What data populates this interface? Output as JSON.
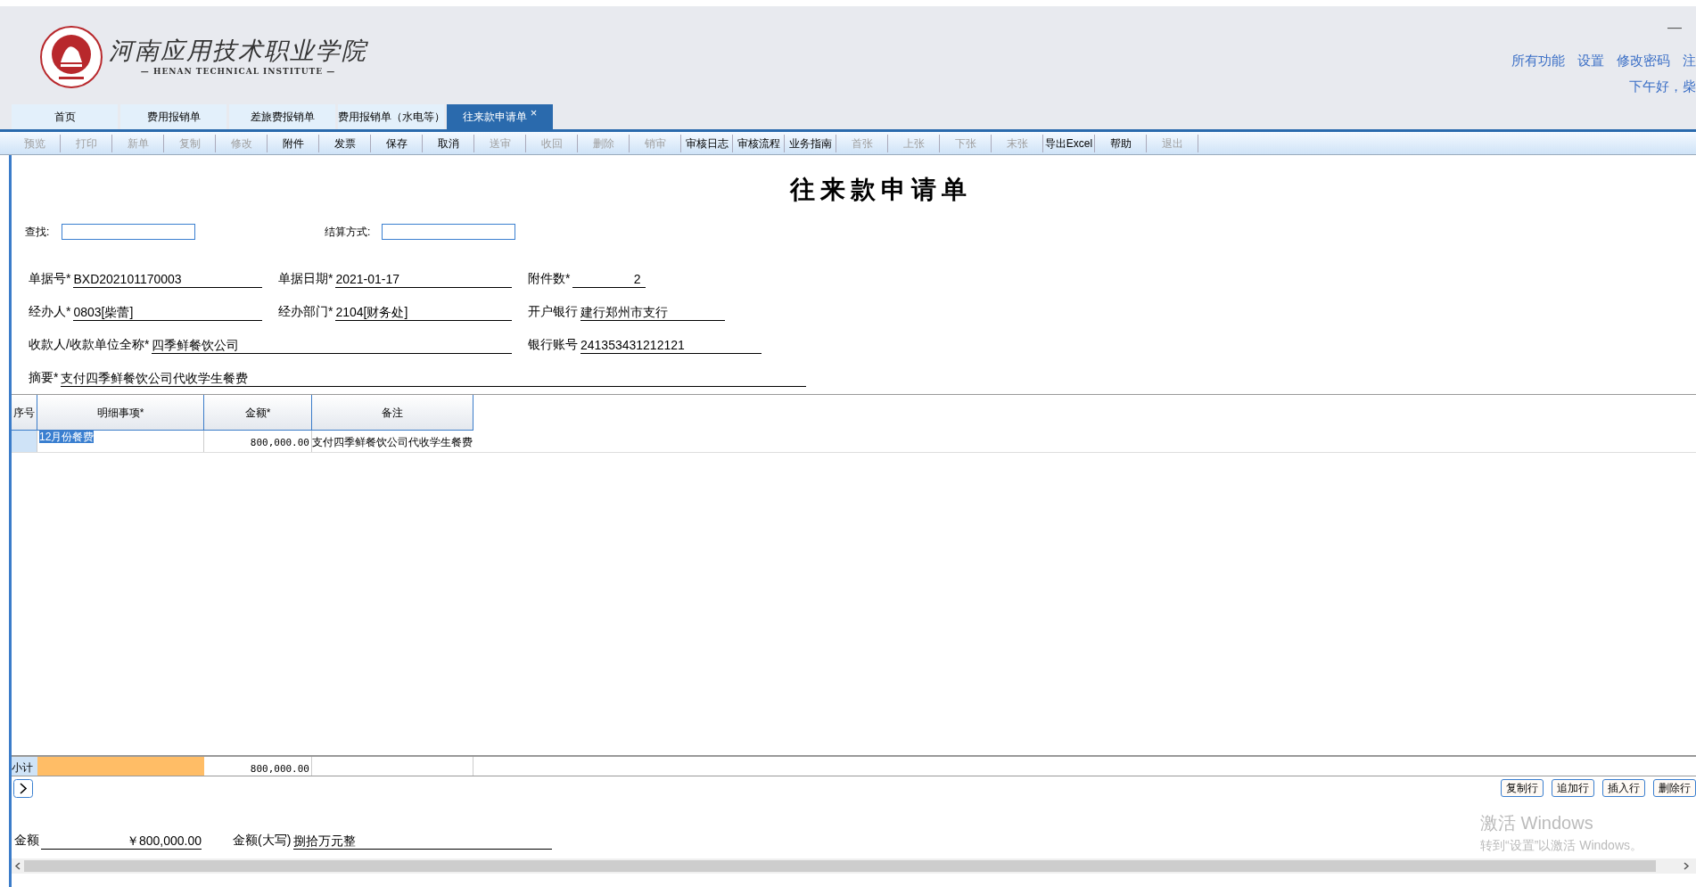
{
  "header": {
    "school_name": "河南应用技术职业学院",
    "school_name_en": "— HENAN TECHNICAL INSTITUTE —",
    "minimize": "—",
    "links": [
      "所有功能",
      "设置",
      "修改密码",
      "注"
    ],
    "greeting": "下午好，柴"
  },
  "tabs": [
    {
      "label": "首页",
      "selected": false
    },
    {
      "label": "费用报销单",
      "selected": false
    },
    {
      "label": "差旅费报销单",
      "selected": false
    },
    {
      "label": "费用报销单（水电等）",
      "selected": false
    },
    {
      "label": "往来款申请单",
      "selected": true,
      "close": "×"
    }
  ],
  "toolbar": [
    {
      "label": "预览",
      "disabled": true
    },
    {
      "label": "打印",
      "disabled": true
    },
    {
      "label": "新单",
      "disabled": true
    },
    {
      "label": "复制",
      "disabled": true
    },
    {
      "label": "修改",
      "disabled": true
    },
    {
      "label": "附件",
      "disabled": false
    },
    {
      "label": "发票",
      "disabled": false
    },
    {
      "label": "保存",
      "disabled": false
    },
    {
      "label": "取消",
      "disabled": false
    },
    {
      "label": "送审",
      "disabled": true
    },
    {
      "label": "收回",
      "disabled": true
    },
    {
      "label": "删除",
      "disabled": true
    },
    {
      "label": "销审",
      "disabled": true
    },
    {
      "label": "审核日志",
      "disabled": false
    },
    {
      "label": "审核流程",
      "disabled": false
    },
    {
      "label": "业务指南",
      "disabled": false
    },
    {
      "label": "首张",
      "disabled": true
    },
    {
      "label": "上张",
      "disabled": true
    },
    {
      "label": "下张",
      "disabled": true
    },
    {
      "label": "末张",
      "disabled": true
    },
    {
      "label": "导出Excel",
      "disabled": false
    },
    {
      "label": "帮助",
      "disabled": false
    },
    {
      "label": "退出",
      "disabled": true
    }
  ],
  "form": {
    "title": "往来款申请单",
    "search_label": "查找:",
    "settlement_label": "结算方式:",
    "fields": [
      {
        "kind": "text",
        "label": "单据号*",
        "value": "BXD202101170003"
      },
      {
        "kind": "text",
        "label": "单据日期*",
        "value": "2021-01-17"
      },
      {
        "kind": "count",
        "label": "附件数*",
        "value": "2"
      },
      {
        "kind": "text",
        "label": "经办人*",
        "value": "0803[柴蕾]"
      },
      {
        "kind": "text",
        "label": "经办部门*",
        "value": "2104[财务处]"
      },
      {
        "kind": "short",
        "label": "开户银行",
        "value": "建行郑州市支行"
      },
      {
        "kind": "wide",
        "label": "收款人/收款单位全称*",
        "value": "四季鲜餐饮公司"
      },
      {
        "kind": "text",
        "label": "银行账号",
        "value": "241353431212121"
      },
      {
        "kind": "full",
        "label": "摘要*",
        "value": "支付四季鲜餐饮公司代收学生餐费"
      }
    ]
  },
  "table": {
    "columns": [
      "序号",
      "明细事项*",
      "金额*",
      "备注"
    ],
    "rows": [
      {
        "selected": true,
        "item": "12月份餐费",
        "amount": "800,000.00",
        "note": "支付四季鲜餐饮公司代收学生餐费"
      }
    ],
    "subtotal_label": "小计",
    "subtotal_amount": "800,000.00"
  },
  "row_buttons": [
    "复制行",
    "追加行",
    "插入行",
    "删除行"
  ],
  "totals": {
    "amount_label": "金额",
    "amount": "￥800,000.00",
    "uppercase_label": "金额(大写)",
    "uppercase": "捌拾万元整"
  },
  "activation": {
    "title": "激活 Windows",
    "subtitle": "转到“设置”以激活 Windows。"
  }
}
